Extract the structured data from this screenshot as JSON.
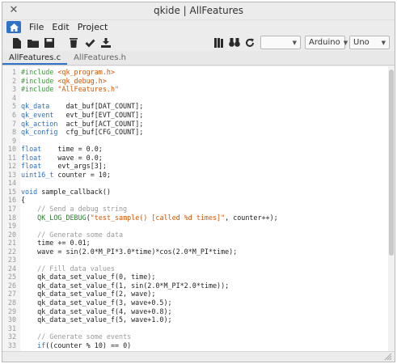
{
  "window": {
    "title": "qkide | AllFeatures"
  },
  "menu": {
    "items": [
      "File",
      "Edit",
      "Project"
    ]
  },
  "toolbar": {
    "port_select": "",
    "board_select": "Arduino",
    "variant_select": "Uno"
  },
  "tabs": [
    {
      "label": "AllFeatures.c",
      "active": true
    },
    {
      "label": "AllFeatures.h",
      "active": false
    }
  ],
  "code_lines": [
    {
      "n": "1",
      "t": "#include <qk_program.h>"
    },
    {
      "n": "2",
      "t": "#include <qk_debug.h>"
    },
    {
      "n": "3",
      "t": "#include \"AllFeatures.h\""
    },
    {
      "n": "4",
      "t": ""
    },
    {
      "n": "5",
      "t": "qk_data    dat_buf[DAT_COUNT];"
    },
    {
      "n": "6",
      "t": "qk_event   evt_buf[EVT_COUNT];"
    },
    {
      "n": "7",
      "t": "qk_action  act_buf[ACT_COUNT];"
    },
    {
      "n": "8",
      "t": "qk_config  cfg_buf[CFG_COUNT];"
    },
    {
      "n": "9",
      "t": ""
    },
    {
      "n": "10",
      "t": "float    time = 0.0;"
    },
    {
      "n": "11",
      "t": "float    wave = 0.0;"
    },
    {
      "n": "12",
      "t": "float    evt_args[3];"
    },
    {
      "n": "13",
      "t": "uint16_t counter = 10;"
    },
    {
      "n": "14",
      "t": ""
    },
    {
      "n": "15",
      "t": "void sample_callback()"
    },
    {
      "n": "16",
      "t": "{"
    },
    {
      "n": "17",
      "t": "    // Send a debug string"
    },
    {
      "n": "18",
      "t": "    QK_LOG_DEBUG(\"test_sample() [called %d times]\", counter++);"
    },
    {
      "n": "19",
      "t": ""
    },
    {
      "n": "20",
      "t": "    // Generate some data"
    },
    {
      "n": "21",
      "t": "    time += 0.01;"
    },
    {
      "n": "22",
      "t": "    wave = sin(2.0*M_PI*3.0*time)*cos(2.0*M_PI*time);"
    },
    {
      "n": "23",
      "t": ""
    },
    {
      "n": "24",
      "t": "    // Fill data values"
    },
    {
      "n": "25",
      "t": "    qk_data_set_value_f(0, time);"
    },
    {
      "n": "26",
      "t": "    qk_data_set_value_f(1, sin(2.0*M_PI*2.0*time));"
    },
    {
      "n": "27",
      "t": "    qk_data_set_value_f(2, wave);"
    },
    {
      "n": "28",
      "t": "    qk_data_set_value_f(3, wave+0.5);"
    },
    {
      "n": "29",
      "t": "    qk_data_set_value_f(4, wave+0.8);"
    },
    {
      "n": "30",
      "t": "    qk_data_set_value_f(5, wave+1.0);"
    },
    {
      "n": "31",
      "t": ""
    },
    {
      "n": "32",
      "t": "    // Generate some events"
    },
    {
      "n": "33",
      "t": "    if((counter % 10) == 0)"
    }
  ],
  "colors": {
    "accent": "#2f72c8",
    "keyword": "#2f6fbf",
    "string": "#d35400",
    "preprocessor": "#3a9a3a",
    "comment": "#9a9a9a"
  }
}
